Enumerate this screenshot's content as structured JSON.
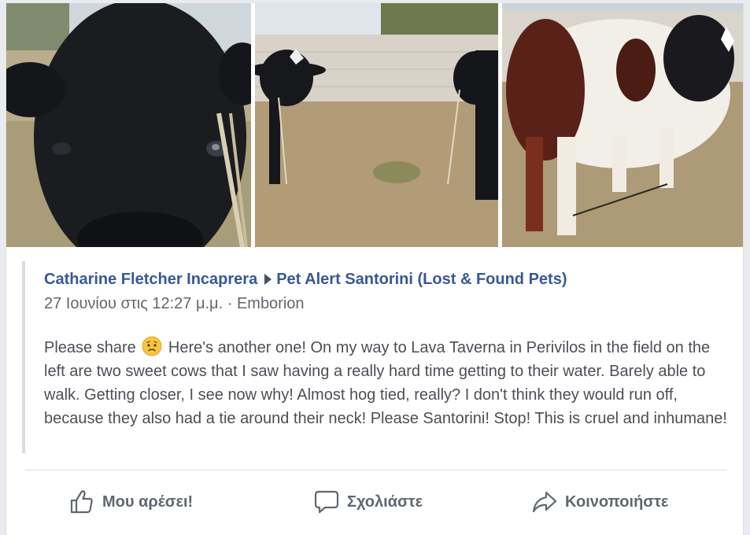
{
  "post": {
    "author": "Catharine Fletcher Incaprera",
    "group": "Pet Alert Santorini (Lost & Found Pets)",
    "timestamp": "27 Ιουνίου στις 12:27 μ.μ.",
    "separator": "·",
    "location": "Emborion",
    "text_before_emoji": "Please share",
    "text_after_emoji": "Here's another one! On my way to Lava Taverna in Perivilos in the field on the left are two sweet cows that I saw having a really hard time getting to their water. Barely able to walk. Getting closer, I see now why! Almost hog tied, really? I don't think they would run off, because they also had a tie around their neck! Please Santorini! Stop! This is cruel and inhumane!",
    "emoji": "worried-face-icon"
  },
  "photos": [
    {
      "name": "black-cow-closeup-photo"
    },
    {
      "name": "two-cows-by-wall-photo"
    },
    {
      "name": "black-white-cow-photo"
    }
  ],
  "actions": {
    "like_label": "Μου αρέσει!",
    "comment_label": "Σχολιάστε",
    "share_label": "Κοινοποιήστε"
  },
  "colors": {
    "link": "#385898",
    "text": "#4b4f56",
    "meta": "#616770",
    "action": "#606770"
  }
}
